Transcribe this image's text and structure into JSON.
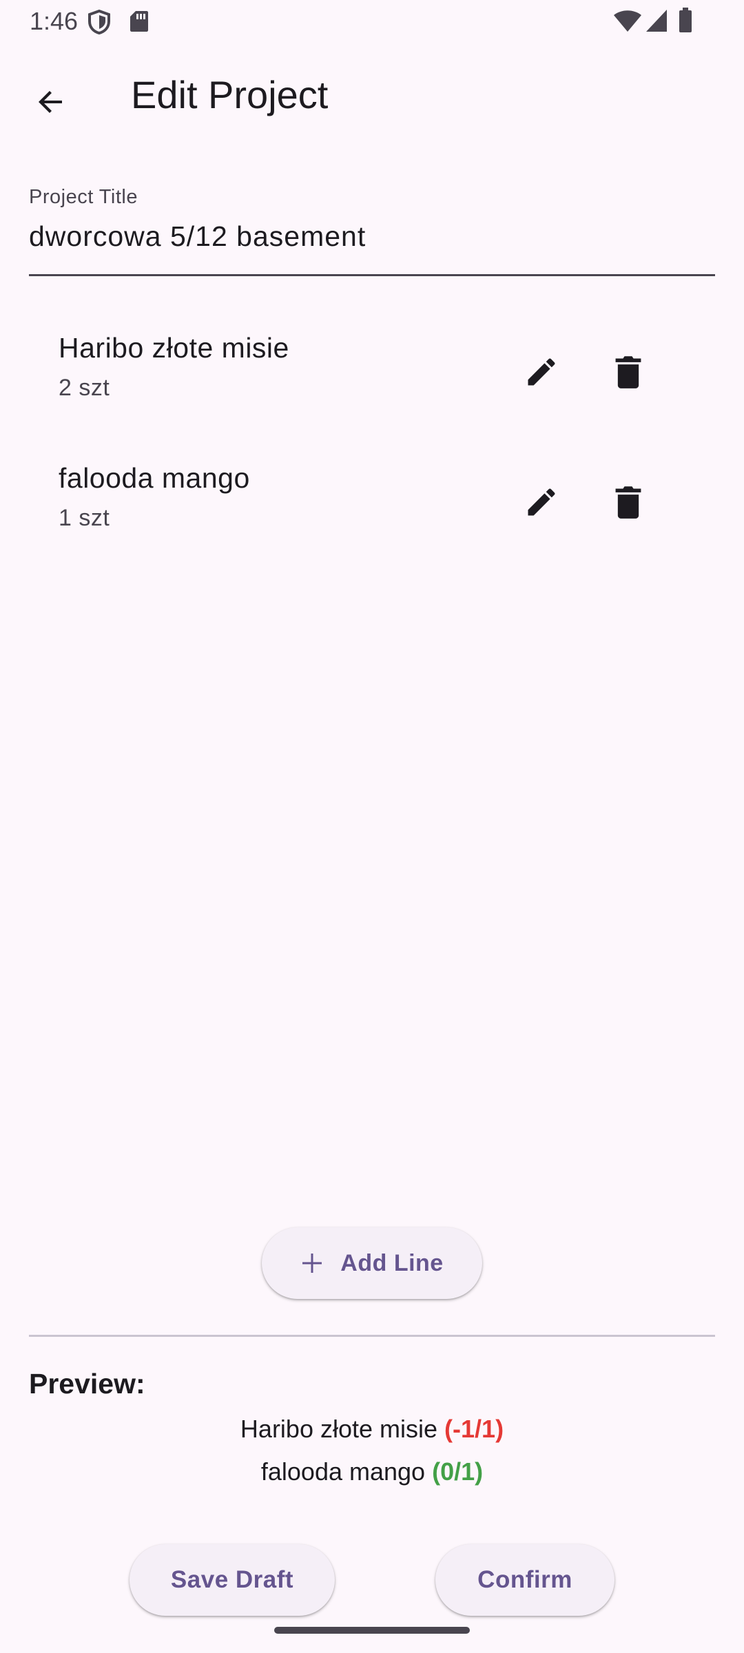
{
  "status_bar": {
    "time": "1:46",
    "icons": [
      "shield-icon",
      "sd-card-icon",
      "wifi-icon",
      "signal-icon",
      "battery-icon"
    ]
  },
  "app_bar": {
    "title": "Edit Project",
    "back_icon": "arrow-back-icon"
  },
  "project_title_field": {
    "label": "Project Title",
    "value": "dworcowa 5/12 basement"
  },
  "items": [
    {
      "name": "Haribo złote misie",
      "qty": "2 szt",
      "edit_icon": "pencil-icon",
      "delete_icon": "trash-icon"
    },
    {
      "name": "falooda mango",
      "qty": "1 szt",
      "edit_icon": "pencil-icon",
      "delete_icon": "trash-icon"
    }
  ],
  "add_line": {
    "label": "Add Line",
    "icon": "plus-icon"
  },
  "preview": {
    "heading": "Preview:",
    "lines": [
      {
        "name": "Haribo złote misie",
        "status": "(-1/1)",
        "status_color": "#e53935"
      },
      {
        "name": "falooda mango",
        "status": "(0/1)",
        "status_color": "#43a047"
      }
    ]
  },
  "actions": {
    "save_draft": "Save Draft",
    "confirm": "Confirm"
  },
  "colors": {
    "background": "#fdf7fc",
    "accent": "#65558f",
    "error": "#e53935",
    "success": "#43a047"
  }
}
